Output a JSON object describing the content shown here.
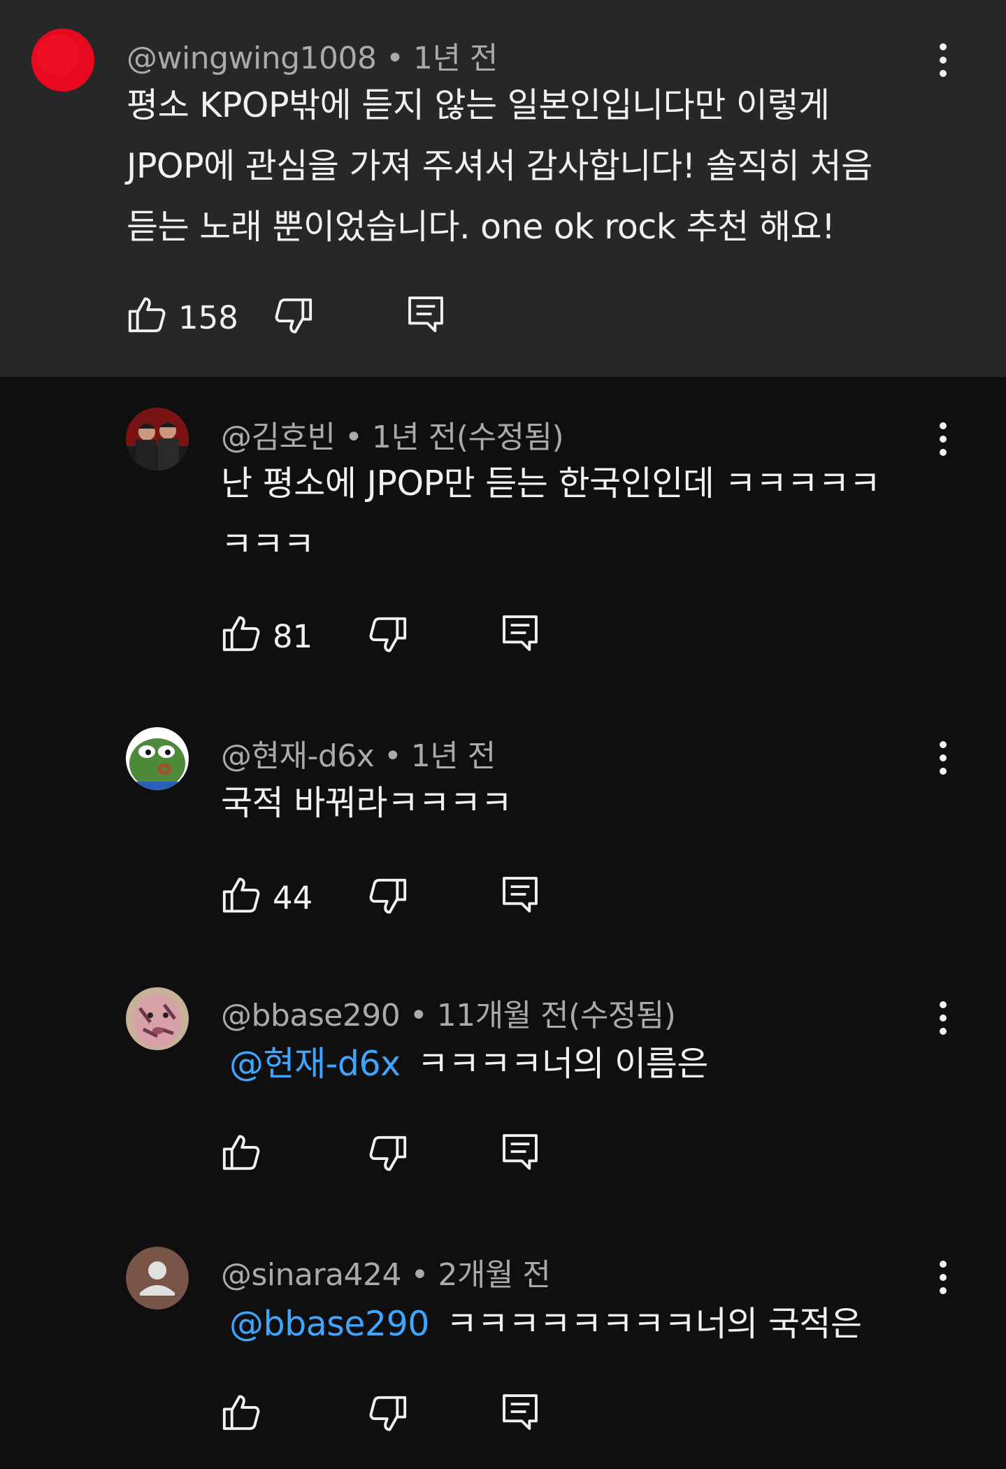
{
  "comments": [
    {
      "author": "@wingwing1008",
      "time": "• 1년 전",
      "lines": [
        "평소 KPOP밖에 듣지 않는 일본인입니다만 이렇게",
        "JPOP에 관심을 가져 주셔서 감사합니다! 솔직히 처음",
        "듣는 노래 뿐이었습니다. one ok rock 추천 해요!"
      ],
      "likes": "158",
      "avatar_color": "#e8091f"
    },
    {
      "author": "@김호빈",
      "time": "• 1년 전(수정됨)",
      "lines": [
        "난 평소에 JPOP만 듣는 한국인인데 ㅋㅋㅋㅋㅋ",
        "ㅋㅋㅋ"
      ],
      "likes": "81"
    },
    {
      "author": "@현재-d6x",
      "time": "• 1년 전",
      "lines": [
        "국적 바꿔라ㅋㅋㅋㅋ"
      ],
      "likes": "44"
    },
    {
      "author": "@bbase290",
      "time": "• 11개월 전(수정됨)",
      "mention": "@현재-d6x",
      "text": "ㅋㅋㅋㅋ너의 이름은",
      "likes": ""
    },
    {
      "author": "@sinara424",
      "time": "• 2개월 전",
      "mention": "@bbase290",
      "text": "ㅋㅋㅋㅋㅋㅋㅋㅋ너의 국적은",
      "likes": ""
    }
  ],
  "icons": [
    "like-icon",
    "dislike-icon",
    "reply-icon",
    "more-options-icon"
  ],
  "colors": {
    "background": "#0f0f0f",
    "highlight": "#272727",
    "mention": "#3ea6ff",
    "meta": "#aaaaaa"
  }
}
